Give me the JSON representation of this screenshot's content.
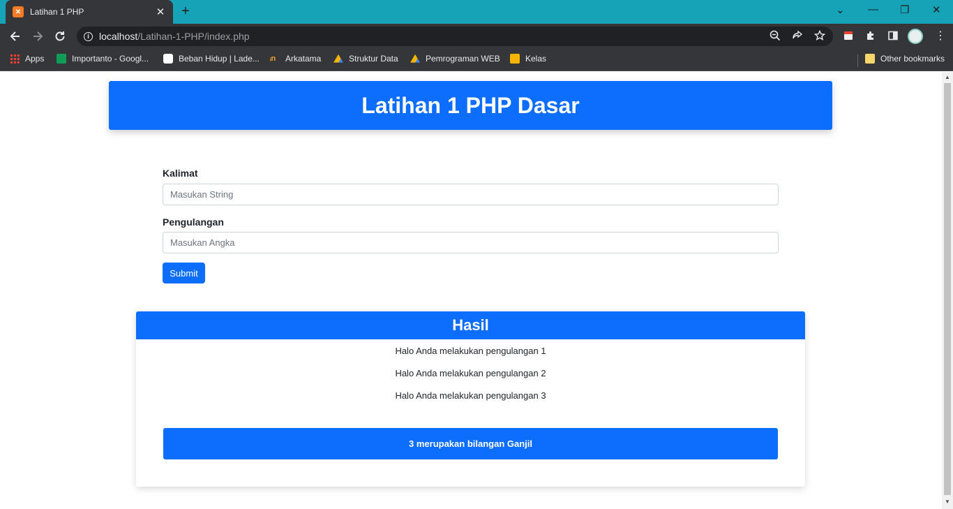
{
  "browser": {
    "tab_title": "Latihan 1 PHP",
    "url_host": "localhost",
    "url_path": "/Latihan-1-PHP/index.php",
    "bookmarks": [
      {
        "label": "Apps",
        "icon": "apps-grid-icon",
        "color": "#ea4335"
      },
      {
        "label": "Importanto - Googl...",
        "icon": "sheets-icon",
        "color": "#0f9d58"
      },
      {
        "label": "Beban Hidup | Lade...",
        "icon": "clickup-icon",
        "color": "#ffffff"
      },
      {
        "label": "Arkatama",
        "icon": "arkatama-icon",
        "color": "#f4a12a"
      },
      {
        "label": "Struktur Data",
        "icon": "drive-icon",
        "color": "#4285f4"
      },
      {
        "label": "Pemrograman WEB",
        "icon": "drive-icon",
        "color": "#4285f4"
      },
      {
        "label": "Kelas",
        "icon": "classroom-icon",
        "color": "#f4b400"
      }
    ],
    "other_bookmarks": "Other bookmarks"
  },
  "page": {
    "header_title": "Latihan 1 PHP Dasar",
    "form": {
      "kalimat_label": "Kalimat",
      "kalimat_placeholder": "Masukan String",
      "pengulangan_label": "Pengulangan",
      "pengulangan_placeholder": "Masukan Angka",
      "submit_label": "Submit"
    },
    "result": {
      "title": "Hasil",
      "lines": [
        "Halo Anda melakukan pengulangan 1",
        "Halo Anda melakukan pengulangan 2",
        "Halo Anda melakukan pengulangan 3"
      ],
      "alert": "3 merupakan bilangan Ganjil"
    }
  },
  "colors": {
    "primary": "#0d6efd",
    "tab_strip": "#17a3b7",
    "chrome_dark": "#35363a"
  }
}
